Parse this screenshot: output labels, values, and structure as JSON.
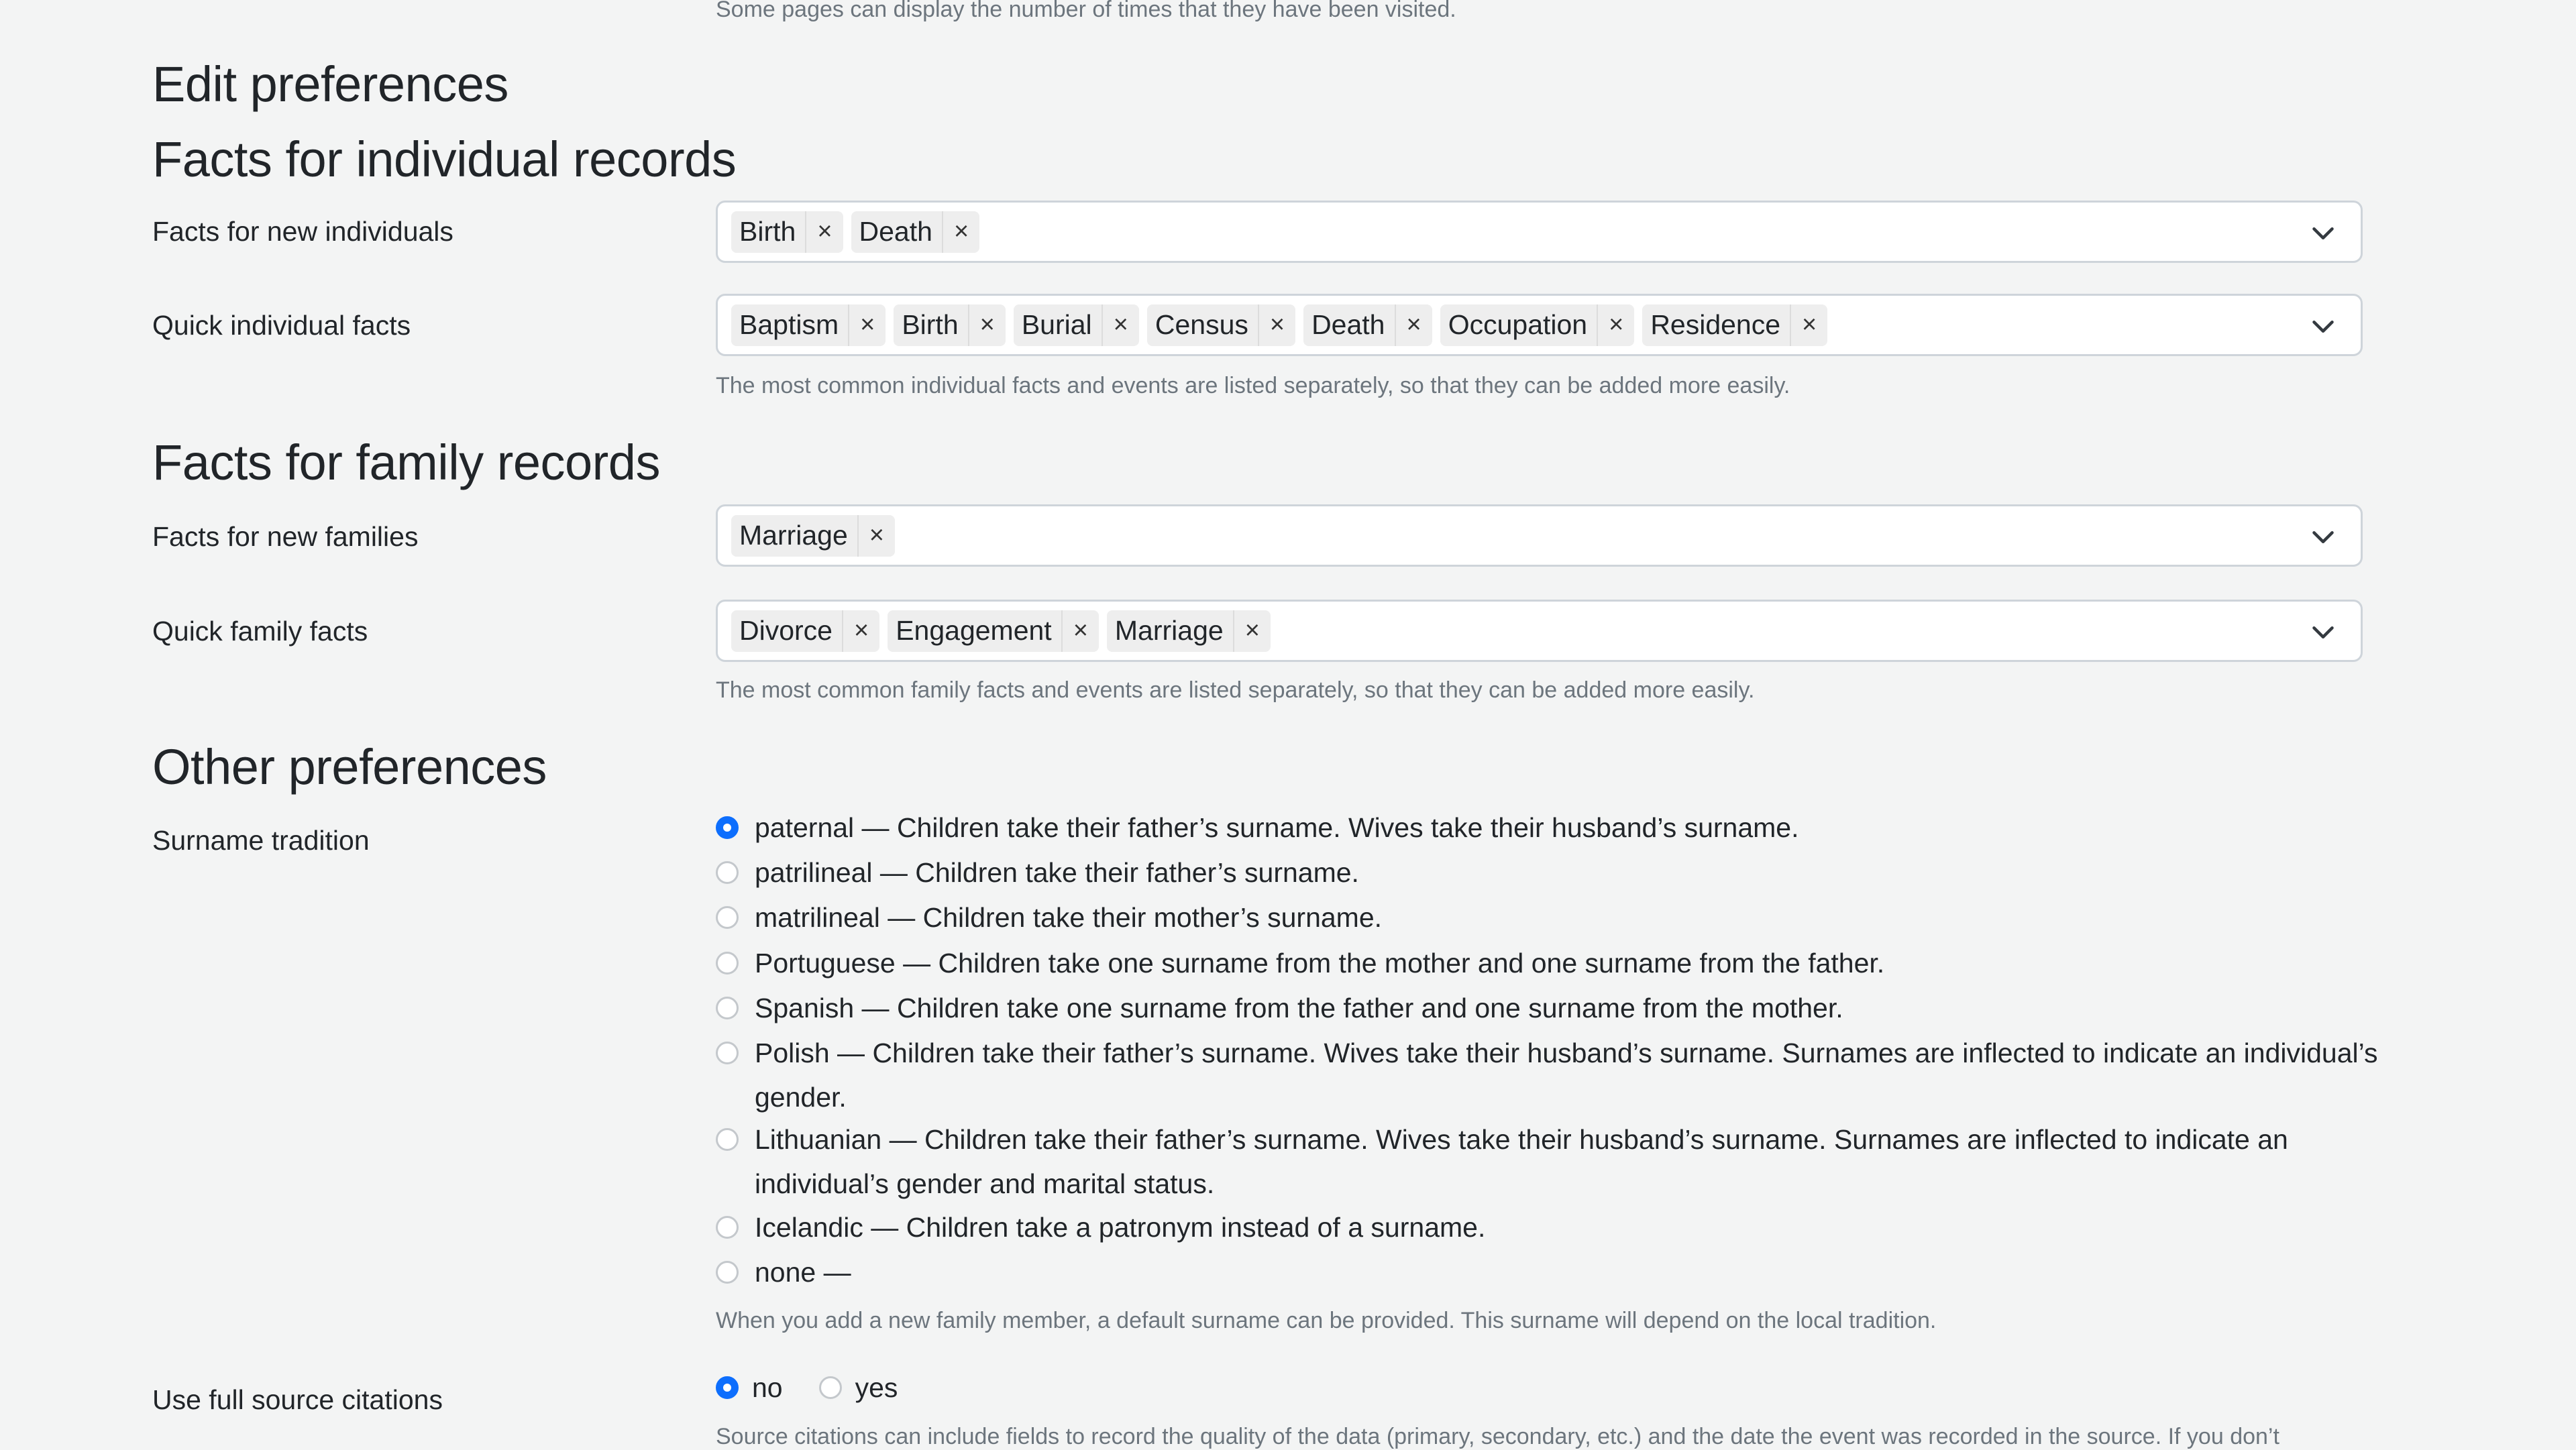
{
  "top_help": "Some pages can display the number of times that they have been visited.",
  "page_title": "Edit preferences",
  "individual": {
    "heading": "Facts for individual records",
    "new_facts": {
      "label": "Facts for new individuals",
      "tags": [
        "Birth",
        "Death"
      ]
    },
    "quick_facts": {
      "label": "Quick individual facts",
      "tags": [
        "Baptism",
        "Birth",
        "Burial",
        "Census",
        "Death",
        "Occupation",
        "Residence"
      ]
    },
    "help": "The most common individual facts and events are listed separately, so that they can be added more easily."
  },
  "family": {
    "heading": "Facts for family records",
    "new_facts": {
      "label": "Facts for new families",
      "tags": [
        "Marriage"
      ]
    },
    "quick_facts": {
      "label": "Quick family facts",
      "tags": [
        "Divorce",
        "Engagement",
        "Marriage"
      ]
    },
    "help": "The most common family facts and events are listed separately, so that they can be added more easily."
  },
  "other": {
    "heading": "Other preferences",
    "surname": {
      "label": "Surname tradition",
      "selected": "paternal",
      "options": [
        {
          "value": "paternal",
          "text": "paternal — Children take their father’s surname. Wives take their husband’s surname."
        },
        {
          "value": "patrilineal",
          "text": "patrilineal — Children take their father’s surname."
        },
        {
          "value": "matrilineal",
          "text": "matrilineal — Children take their mother’s surname."
        },
        {
          "value": "portuguese",
          "text": "Portuguese — Children take one surname from the mother and one surname from the father."
        },
        {
          "value": "spanish",
          "text": "Spanish — Children take one surname from the father and one surname from the mother."
        },
        {
          "value": "polish",
          "text": "Polish — Children take their father’s surname. Wives take their husband’s surname. Surnames are inflected to indicate an individual’s gender."
        },
        {
          "value": "lithuanian",
          "text": "Lithuanian — Children take their father’s surname. Wives take their husband’s surname. Surnames are inflected to indicate an individual’s gender and marital status."
        },
        {
          "value": "icelandic",
          "text": "Icelandic — Children take a patronym instead of a surname."
        },
        {
          "value": "none",
          "text": "none —"
        }
      ],
      "help": "When you add a new family member, a default surname can be provided. This surname will depend on the local tradition."
    },
    "citations": {
      "label": "Use full source citations",
      "selected": "no",
      "options": [
        {
          "value": "no",
          "text": "no"
        },
        {
          "value": "yes",
          "text": "yes"
        }
      ],
      "help": "Source citations can include fields to record the quality of the data (primary, secondary, etc.) and the date the event was recorded in the source. If you don’t"
    }
  },
  "colors": {
    "accent": "#0d6efd",
    "background": "#f3f4f4",
    "muted_text": "#6c757d",
    "tag_bg": "#eeeeee"
  },
  "icons": {
    "tag_remove": "×",
    "select_chevron": "chevron-down-icon"
  }
}
